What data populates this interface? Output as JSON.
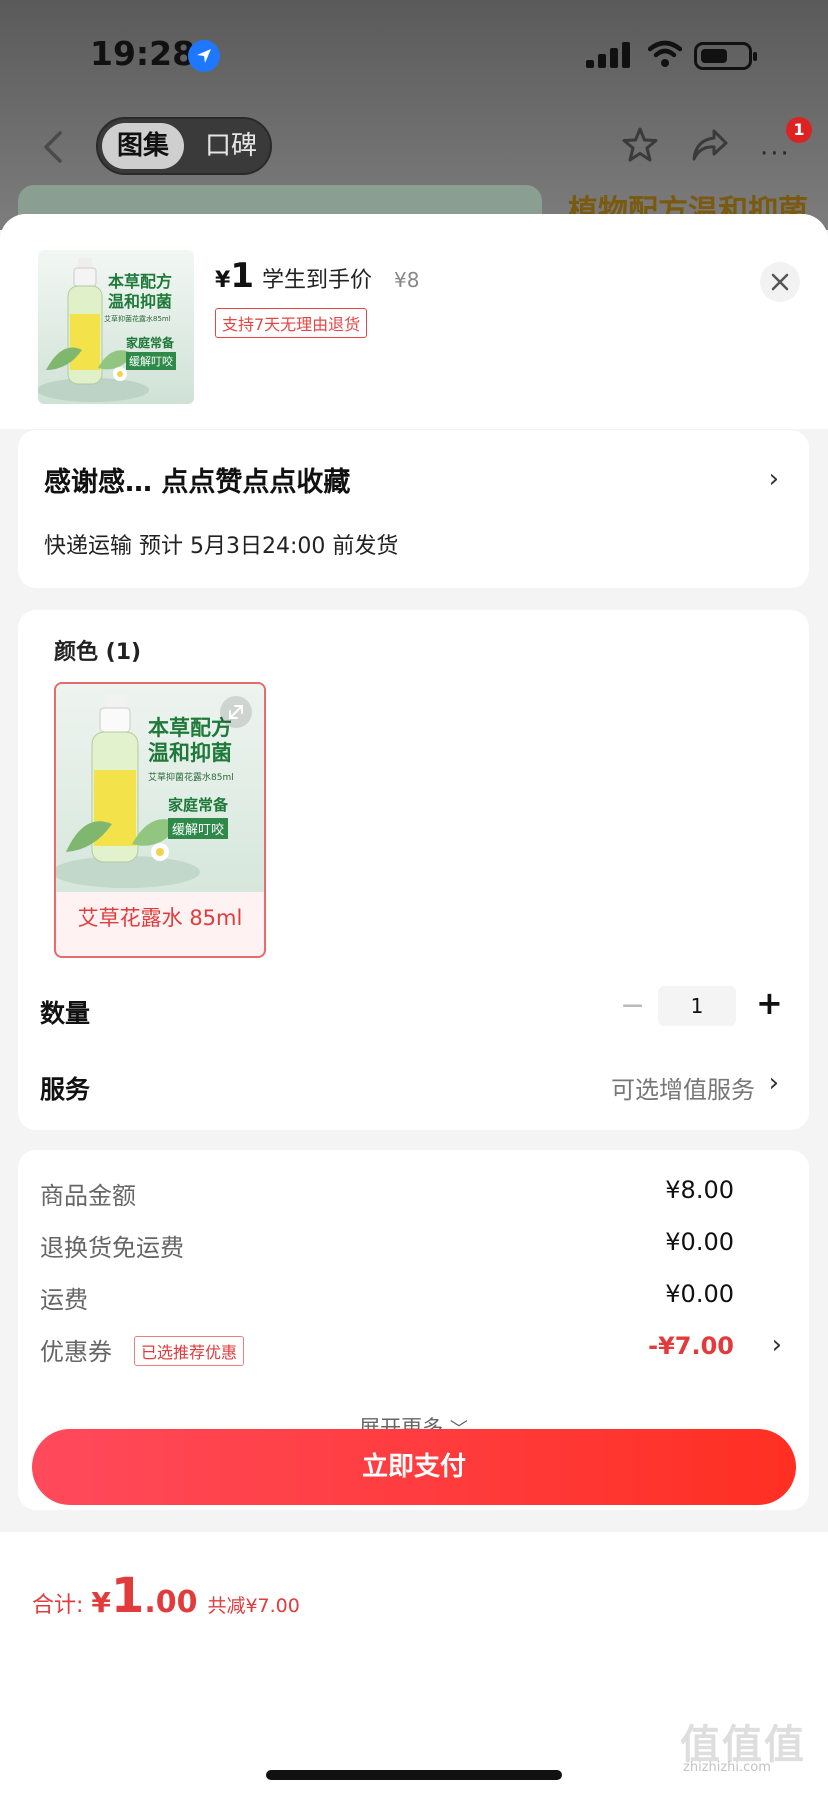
{
  "status_bar": {
    "time": "19:28"
  },
  "nav": {
    "tabs": [
      {
        "label": "图集",
        "active": true
      },
      {
        "label": "口碑",
        "active": false
      }
    ],
    "badge_count": "1",
    "more_label": "···"
  },
  "background_banner": {
    "text": "植物配方温和抑菌"
  },
  "product": {
    "currency": "¥",
    "price": "1",
    "price_label": "学生到手价",
    "original_price": "¥8",
    "return_tag": "支持7天无理由退货",
    "image_text": {
      "headline": [
        "本草配方",
        "温和抑菌"
      ],
      "subline": "艾草抑菌花露水85ml",
      "tags": [
        "家庭常备",
        "缓解叮咬"
      ]
    }
  },
  "address": {
    "name": "感谢感… 点点赞点点收藏",
    "shipping": "快递运输 预计 5月3日24:00 前发货"
  },
  "spec": {
    "color_title": "颜色 (1)",
    "sku_label": "艾草花露水 85ml",
    "quantity_label": "数量",
    "quantity": "1",
    "service_label": "服务",
    "service_value": "可选增值服务"
  },
  "fees": {
    "rows": [
      {
        "label": "商品金额",
        "value": "¥8.00"
      },
      {
        "label": "退换货免运费",
        "value": "¥0.00"
      },
      {
        "label": "运费",
        "value": "¥0.00"
      },
      {
        "label": "优惠券",
        "value": "-¥7.00",
        "tag": "已选推荐优惠"
      }
    ],
    "expand_label": "展开更多"
  },
  "footer": {
    "total_label": "合计:",
    "total_yen": "¥",
    "total_int": "1",
    "total_dec": ".00",
    "savings": "共减¥7.00",
    "pay_label": "立即支付"
  },
  "watermark": {
    "main": "值值值",
    "sub": "zhizhizhi.com"
  },
  "colors": {
    "accent": "#e23b3b",
    "pay_gradient_start": "#ff4a5c",
    "pay_gradient_end": "#ff2f22"
  }
}
